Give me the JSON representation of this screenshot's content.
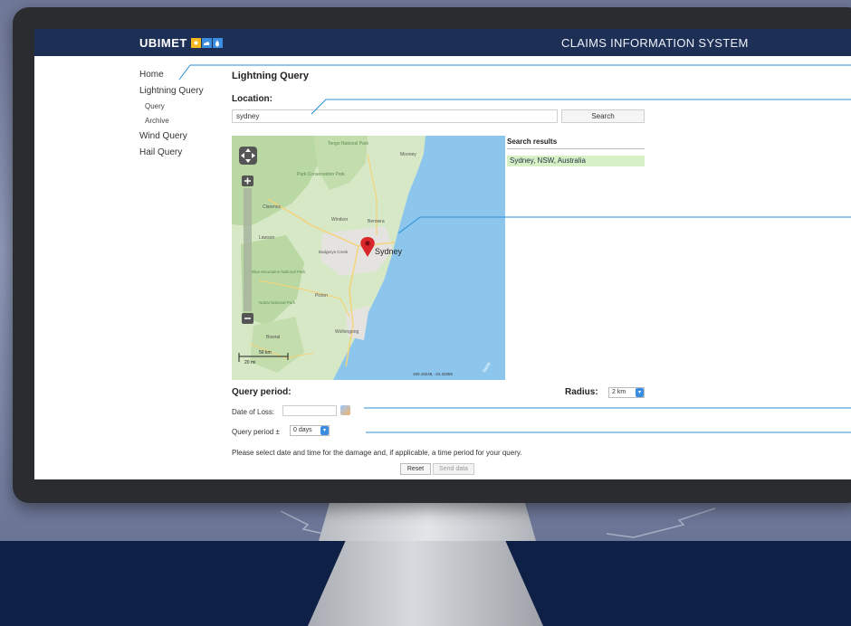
{
  "header": {
    "brand": "UBIMET",
    "system_title": "CLAIMS INFORMATION SYSTEM",
    "brand_icons": [
      "sun-icon",
      "cloud-icon",
      "drop-icon"
    ]
  },
  "sidebar": {
    "items": [
      {
        "label": "Home"
      },
      {
        "label": "Lightning Query"
      },
      {
        "label": "Query"
      },
      {
        "label": "Archive"
      },
      {
        "label": "Wind Query"
      },
      {
        "label": "Hail Query"
      }
    ]
  },
  "main": {
    "title": "Lightning Query",
    "location_label": "Location:",
    "location_value": "sydney",
    "search_button": "Search",
    "search_results_title": "Search results",
    "search_results": [
      "Sydney, NSW, Australia"
    ]
  },
  "map": {
    "city_labels": [
      "Sydney",
      "Tengo National Park",
      "Park Conservation Park",
      "Mooney",
      "Windsor",
      "Berowra",
      "Clarence",
      "Lawson",
      "Badgerys Creek",
      "Blue Mountains National Park",
      "Nattai National Park",
      "Picton",
      "Wollongong",
      "Bowral"
    ],
    "scale_km": "50 km",
    "scale_mi": "20 mi",
    "coordinates": "150.18248, -34.33355",
    "provider": "here",
    "colors": {
      "water": "#8dc6ec",
      "land": "#d7e8c6",
      "park": "#b9d8a3",
      "urban": "#e5e3df",
      "marker": "#d9262b"
    }
  },
  "query_period": {
    "title": "Query period:",
    "radius_label": "Radius:",
    "radius_value": "2 km",
    "date_of_loss_label": "Date of Loss:",
    "date_of_loss_value": "",
    "query_period_label": "Query period ±",
    "query_period_value": "0 days",
    "instructions": "Please select date and time for the damage and, if applicable, a time period for your query.",
    "reset_button": "Reset",
    "send_button": "Send data"
  },
  "colors": {
    "header_bg": "#1e2f56",
    "accent_blue": "#3b8de0",
    "result_highlight": "#d8f0c6",
    "callout_line": "#2a8fd6",
    "backdrop_bottom": "#0f2046"
  }
}
